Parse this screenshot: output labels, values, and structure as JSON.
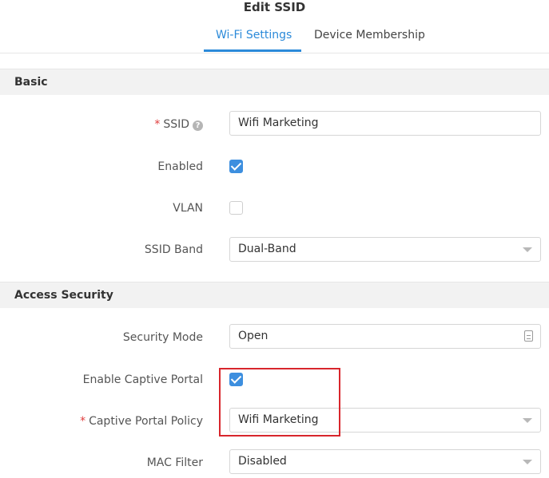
{
  "dialog": {
    "title": "Edit SSID"
  },
  "tabs": [
    {
      "label": "Wi-Fi Settings",
      "active": true
    },
    {
      "label": "Device Membership",
      "active": false
    }
  ],
  "sections": {
    "basic": {
      "title": "Basic"
    },
    "access_security": {
      "title": "Access Security"
    }
  },
  "fields": {
    "ssid": {
      "label": "SSID",
      "required_mark": "*",
      "help_icon": "?",
      "value": "Wifi Marketing"
    },
    "enabled": {
      "label": "Enabled",
      "checked": true
    },
    "vlan": {
      "label": "VLAN",
      "checked": false
    },
    "ssid_band": {
      "label": "SSID Band",
      "value": "Dual-Band"
    },
    "security_mode": {
      "label": "Security Mode",
      "value": "Open"
    },
    "enable_captive_portal": {
      "label": "Enable Captive Portal",
      "checked": true
    },
    "captive_portal_policy": {
      "label": "Captive Portal Policy",
      "required_mark": "*",
      "value": "Wifi Marketing"
    },
    "mac_filter": {
      "label": "MAC Filter",
      "value": "Disabled"
    }
  },
  "colors": {
    "accent": "#2b8ad9",
    "checkbox": "#3d8fdf",
    "required": "#e03c3c",
    "highlight": "#d8262c"
  }
}
